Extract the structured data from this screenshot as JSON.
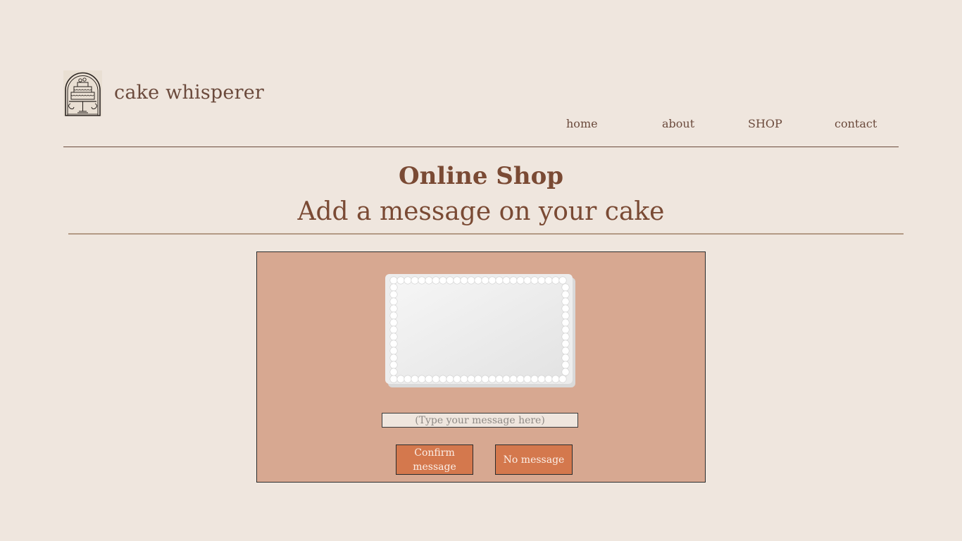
{
  "header": {
    "brand_name": "cake whisperer",
    "logo_icon": "cake-stand-logo-icon"
  },
  "nav": {
    "items": [
      {
        "label": "home"
      },
      {
        "label": "about"
      },
      {
        "label": "SHOP"
      },
      {
        "label": "contact"
      }
    ]
  },
  "main": {
    "title": "Online Shop",
    "subtitle": "Add a message on your cake"
  },
  "message_panel": {
    "cake_image": "rectangular-white-frosted-cake",
    "input_placeholder": "(Type your message here)",
    "input_value": "",
    "confirm_label": "Confirm message",
    "no_message_label": "No message"
  },
  "colors": {
    "background": "#efe6de",
    "accent_brown": "#7a4a34",
    "panel": "#d7a891",
    "button": "#d4784d"
  }
}
